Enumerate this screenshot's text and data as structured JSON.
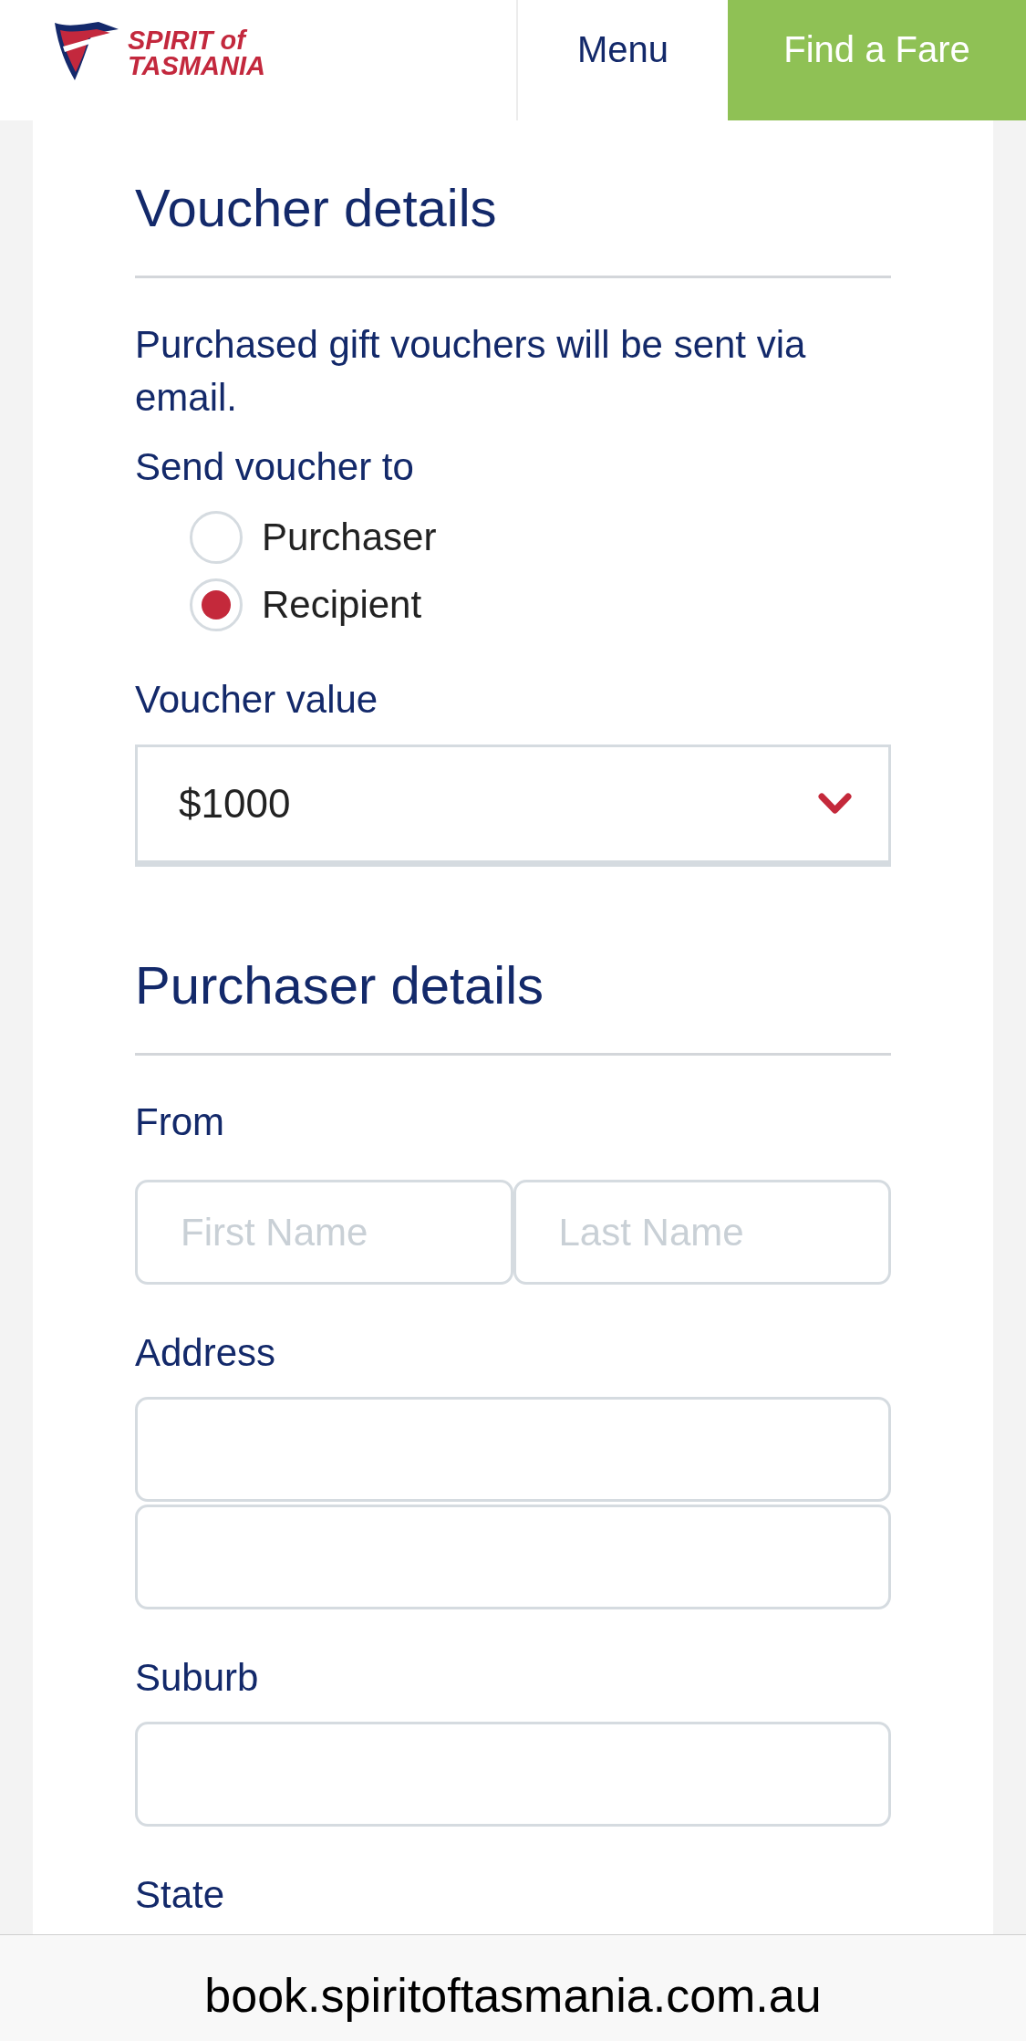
{
  "header": {
    "logo": {
      "lines": [
        "SPIRIT of",
        "TASMANIA"
      ]
    },
    "menu_button": "Menu",
    "cta_button": "Find a Fare"
  },
  "sections": [
    {
      "title": "Voucher details",
      "fields": [
        {
          "kind": "note",
          "text": "Purchased gift vouchers will be sent via email."
        },
        {
          "kind": "radio_group",
          "label": "Send voucher to",
          "options": [
            {
              "label": "Purchaser",
              "selected": false
            },
            {
              "label": "Recipient",
              "selected": true
            }
          ]
        },
        {
          "kind": "select",
          "label": "Voucher value",
          "value": "$1000"
        }
      ]
    },
    {
      "title": "Purchaser details",
      "fields": [
        {
          "kind": "input_row",
          "label": "From",
          "inputs": [
            {
              "kind": "text",
              "placeholder": "First Name"
            },
            {
              "kind": "text",
              "placeholder": "Last Name"
            }
          ]
        },
        {
          "kind": "input_stack",
          "label": "Address",
          "inputs": [
            {
              "kind": "text"
            },
            {
              "kind": "text"
            }
          ]
        },
        {
          "kind": "input_stack",
          "label": "Suburb",
          "inputs": [
            {
              "kind": "text"
            }
          ]
        },
        {
          "kind": "label",
          "label": "State"
        }
      ]
    }
  ],
  "address_bar": {
    "url": "book.spiritoftasmania.com.au"
  }
}
